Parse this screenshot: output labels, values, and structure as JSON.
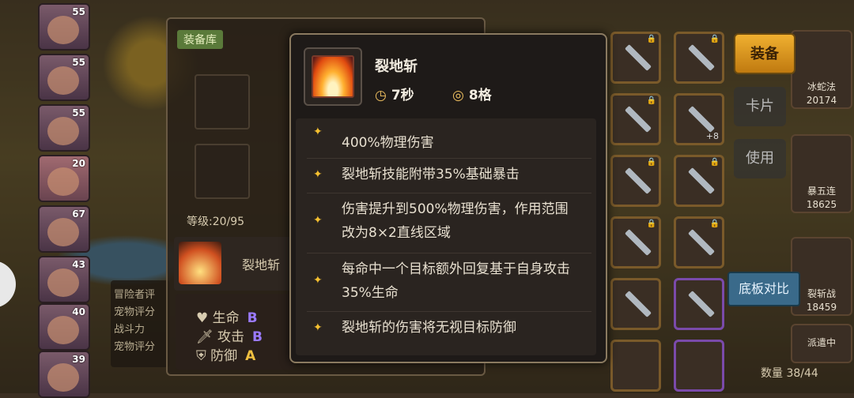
{
  "equipment_panel": {
    "tag": "装备库",
    "level_text": "等级:20/95",
    "skill_name": "裂地斩",
    "stats": [
      {
        "label": "生命",
        "grade": "B"
      },
      {
        "label": "攻击",
        "grade": "B"
      },
      {
        "label": "防御",
        "grade": "A"
      }
    ]
  },
  "side_info": {
    "lines": [
      "冒险者评",
      "宠物评分",
      "战斗力",
      "宠物评分"
    ]
  },
  "roster_levels": [
    "55",
    "55",
    "55",
    "20",
    "67",
    "43",
    "40",
    "39"
  ],
  "tooltip": {
    "skill_name": "裂地斩",
    "cooldown": "7秒",
    "range": "8格",
    "cooldown_icon": "clock-icon",
    "range_icon": "target-icon",
    "effects": [
      "400%物理伤害",
      "裂地斩技能附带35%基础暴击",
      "伤害提升到500%物理伤害，作用范围改为8×2直线区域",
      "每命中一个目标额外回复基于自身攻击35%生命",
      "裂地斩的伤害将无视目标防御"
    ]
  },
  "right_panel": {
    "equip_button": "装备",
    "card_button": "卡片",
    "use_button": "使用",
    "compare_button": "底板对比",
    "heroes": [
      {
        "name": "冰蛇法",
        "power": "20174"
      },
      {
        "name": "暴五连",
        "power": "18625"
      },
      {
        "name": "裂斩战",
        "power": "18459"
      },
      {
        "name": "派遣中",
        "power": ""
      }
    ],
    "count_label": "数量",
    "count_value": "38/44"
  },
  "colors": {
    "accent_gold": "#f0b030",
    "grade_b": "#9a7aff",
    "grade_a": "#f0c040",
    "star": "#f5c030"
  }
}
